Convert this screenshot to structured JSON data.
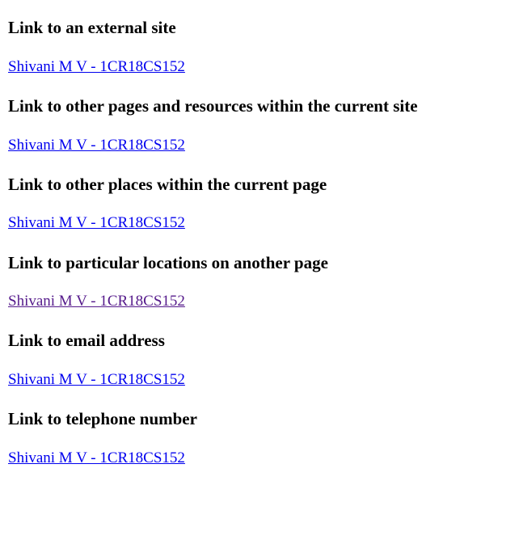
{
  "sections": [
    {
      "heading": "Link to an external site",
      "link_text": "Shivani M V - 1CR18CS152",
      "link_state": "unvisited"
    },
    {
      "heading": "Link to other pages and resources within the current site",
      "link_text": "Shivani M V - 1CR18CS152",
      "link_state": "unvisited"
    },
    {
      "heading": "Link to other places within the current page",
      "link_text": "Shivani M V - 1CR18CS152",
      "link_state": "unvisited"
    },
    {
      "heading": "Link to particular locations on another page",
      "link_text": "Shivani M V - 1CR18CS152",
      "link_state": "visited"
    },
    {
      "heading": "Link to email address",
      "link_text": "Shivani M V - 1CR18CS152",
      "link_state": "unvisited"
    },
    {
      "heading": "Link to telephone number",
      "link_text": "Shivani M V - 1CR18CS152",
      "link_state": "unvisited"
    }
  ],
  "colors": {
    "link_unvisited": "#0000EE",
    "link_visited": "#551A8B",
    "text": "#000000",
    "background": "#FFFFFF"
  }
}
